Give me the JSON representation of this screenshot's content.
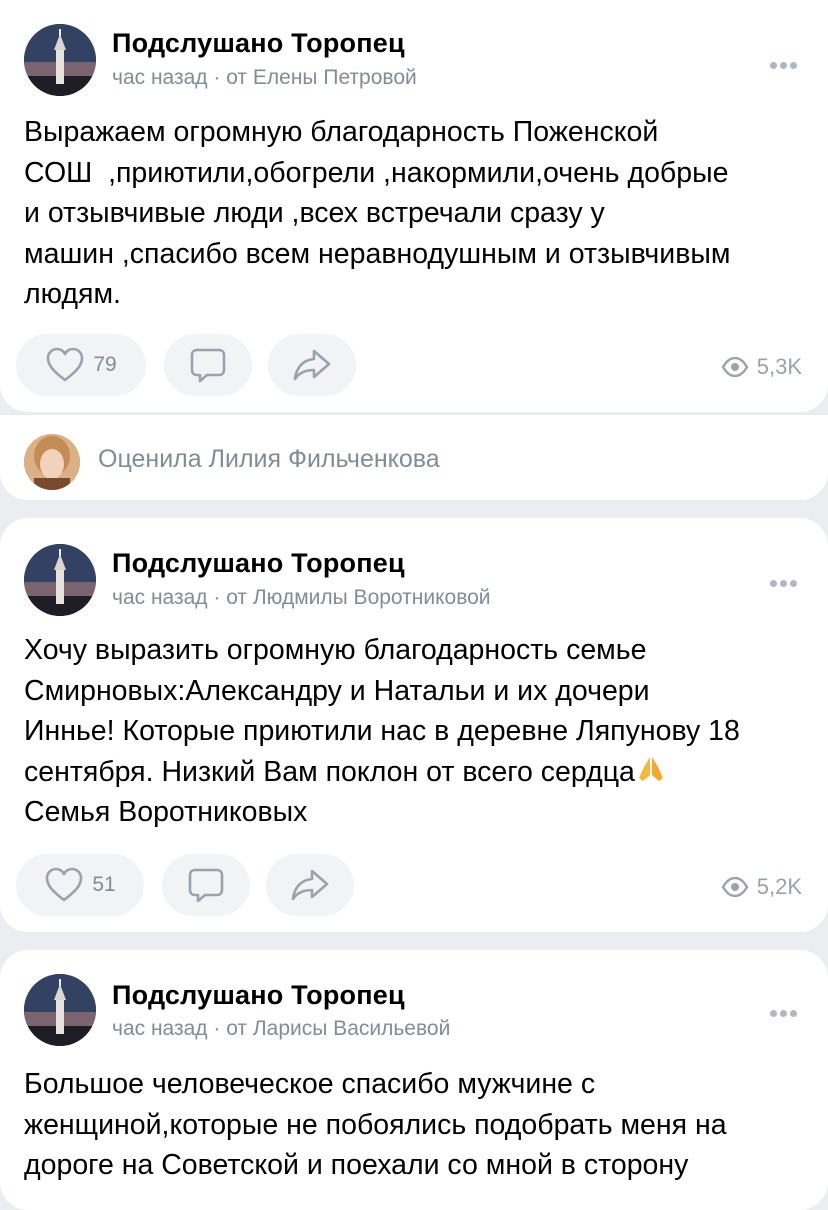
{
  "posts": [
    {
      "group": "Подслушано Торопец",
      "meta": "час назад · от Елены Петровой",
      "text": "Выражаем огромную благодарность Поженской\nСОШ  ,приютили,обогрели ,накормили,очень добрые\nи отзывчивые люди ,всех встречали сразу у\nмашин ,спасибо всем неравнодушным и отзывчивым\nлюдям.",
      "likes": "79",
      "views": "5,3K"
    },
    {
      "group": "Подслушано Торопец",
      "meta": "час назад · от Людмилы Воротниковой",
      "text_main": "Хочу выразить огромную благодарность семье\nСмирновых:Александру и Натальи и их дочери\nИнньe! Которые приютили нас в деревне Ляпунову 18\nсентября. Низкий Вам поклон от всего сердца",
      "text_tail": "\nСемья Воротниковых",
      "likes": "51",
      "views": "5,2K"
    },
    {
      "group": "Подслушано Торопец",
      "meta": "час назад · от Ларисы Васильевой",
      "text": "Большое человеческое спасибо мужчине с\nженщиной,которые не побоялись подобрать меня на\nдороге на Советской и поехали со мной в сторону"
    }
  ],
  "liked_by": "Оценила Лилия Фильченкова",
  "icons": {
    "like": "heart-icon",
    "comment": "comment-icon",
    "share": "share-icon",
    "views": "eye-icon",
    "more": "more-dots-icon",
    "emoji": "folded-hands-emoji"
  }
}
